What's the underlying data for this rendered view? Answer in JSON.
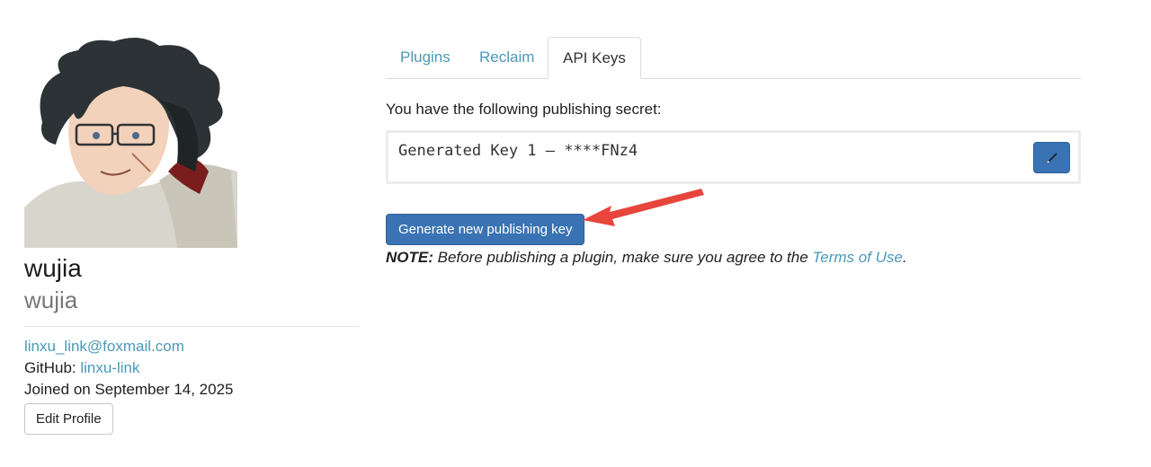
{
  "profile": {
    "display_name": "wujia",
    "username": "wujia",
    "email": "linxu_link@foxmail.com",
    "github_label": "GitHub:",
    "github_user": "linxu-link",
    "joined": "Joined on September 14, 2025",
    "edit_button": "Edit Profile"
  },
  "tabs": [
    {
      "label": "Plugins",
      "active": false
    },
    {
      "label": "Reclaim",
      "active": false
    },
    {
      "label": "API Keys",
      "active": true
    }
  ],
  "api_keys": {
    "secret_label": "You have the following publishing secret:",
    "key_text": "Generated Key 1 — ****FNz4",
    "generate_button": "Generate new publishing key",
    "note_prefix": "NOTE:",
    "note_text": " Before publishing a plugin, make sure you agree to the ",
    "terms_link": "Terms of Use",
    "note_suffix": "."
  },
  "colors": {
    "link": "#4a9ab8",
    "primary_button": "#3a73b3",
    "annotation_arrow": "#e8453c"
  },
  "icons": {
    "edit_key": "pencil-icon"
  }
}
